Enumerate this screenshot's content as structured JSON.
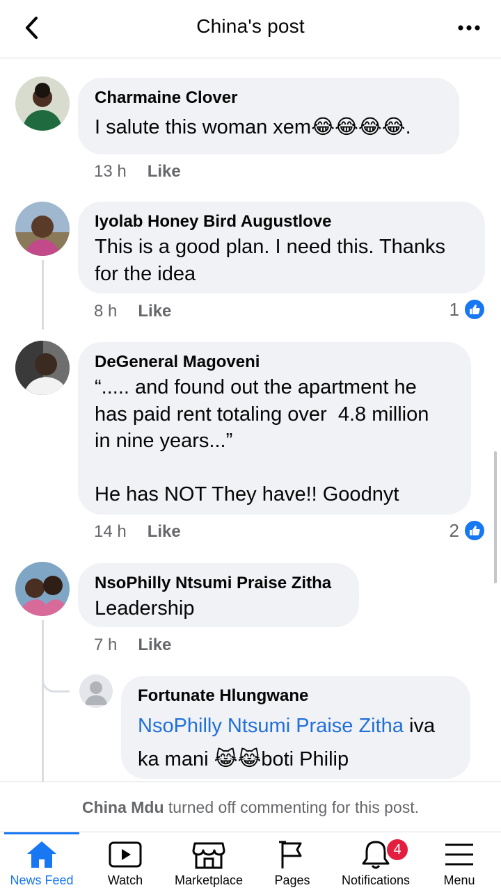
{
  "header": {
    "title": "China's post"
  },
  "comments": [
    {
      "author": "Charmaine Clover",
      "text": "I salute this woman xem😂😂😂😂.",
      "time": "13 h",
      "like_label": "Like"
    },
    {
      "author": "Iyolab Honey Bird Augustlove",
      "text": "This is a good plan. I need this. Thanks\nfor the idea",
      "time": "8 h",
      "like_label": "Like",
      "reaction_count": "1"
    },
    {
      "author": "DeGeneral Magoveni",
      "text": "“..... and found out the apartment he\nhas paid rent totaling over  4.8 million\nin nine years...”\n\nHe has NOT They have!! Goodnyt",
      "time": "14 h",
      "like_label": "Like",
      "reaction_count": "2"
    },
    {
      "author": "NsoPhilly Ntsumi Praise Zitha",
      "text": "Leadership",
      "time": "7 h",
      "like_label": "Like"
    }
  ],
  "reply": {
    "author": "Fortunate Hlungwane",
    "mention": "NsoPhilly Ntsumi Praise Zitha",
    "text_after_mention": " iva\nka mani 😹😹boti Philip"
  },
  "notice": {
    "name": "China Mdu",
    "text": " turned off commenting for this post."
  },
  "nav": {
    "items": [
      {
        "label": "News Feed",
        "icon": "home-icon",
        "active": true
      },
      {
        "label": "Watch",
        "icon": "watch-icon"
      },
      {
        "label": "Marketplace",
        "icon": "marketplace-icon"
      },
      {
        "label": "Pages",
        "icon": "flag-icon"
      },
      {
        "label": "Notifications",
        "icon": "bell-icon",
        "badge": "4"
      },
      {
        "label": "Menu",
        "icon": "hamburger-icon"
      }
    ]
  },
  "colors": {
    "accent": "#1877f2",
    "bubble": "#f0f2f5",
    "secondary_text": "#65676b",
    "mention": "#216fdb",
    "badge": "#e41e3f"
  }
}
